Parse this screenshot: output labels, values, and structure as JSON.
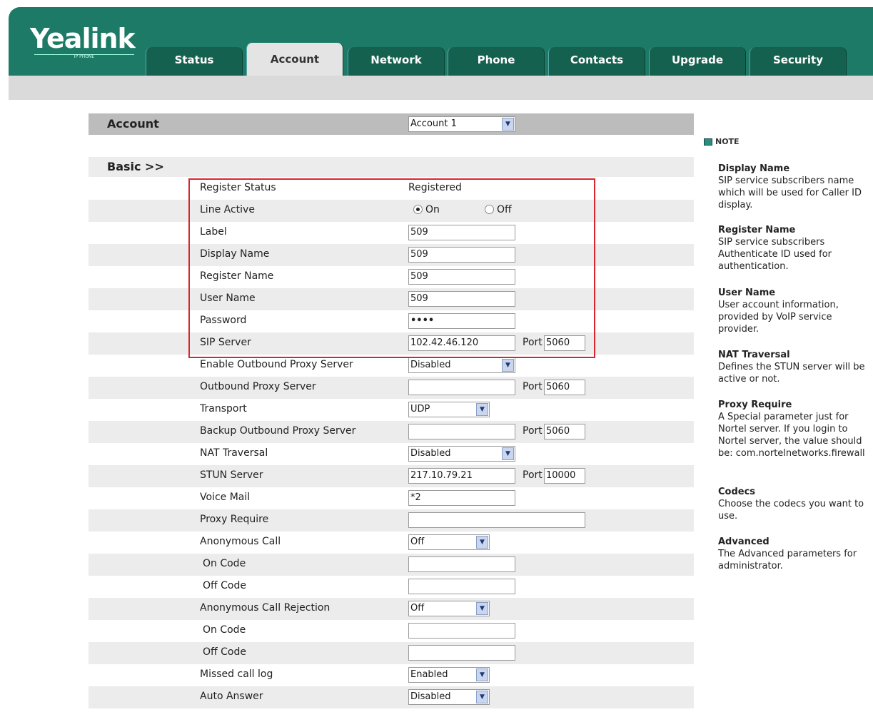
{
  "brand": {
    "logo": "Yealink",
    "tagline": "IP PHONE"
  },
  "tabs": [
    {
      "label": "Status",
      "active": false
    },
    {
      "label": "Account",
      "active": true
    },
    {
      "label": "Network",
      "active": false
    },
    {
      "label": "Phone",
      "active": false
    },
    {
      "label": "Contacts",
      "active": false
    },
    {
      "label": "Upgrade",
      "active": false
    },
    {
      "label": "Security",
      "active": false
    }
  ],
  "account": {
    "title": "Account",
    "selected": "Account 1"
  },
  "basic": {
    "title": "Basic >>"
  },
  "fields": {
    "register_status": {
      "label": "Register Status",
      "value": "Registered"
    },
    "line_active": {
      "label": "Line Active",
      "on": "On",
      "off": "Off",
      "selected": "On"
    },
    "label": {
      "label": "Label",
      "value": "509"
    },
    "display_name": {
      "label": "Display Name",
      "value": "509"
    },
    "register_name": {
      "label": "Register Name",
      "value": "509"
    },
    "user_name": {
      "label": "User Name",
      "value": "509"
    },
    "password": {
      "label": "Password",
      "value": "••••"
    },
    "sip_server": {
      "label": "SIP Server",
      "value": "102.42.46.120",
      "port_label": "Port",
      "port": "5060"
    },
    "enable_outbound": {
      "label": "Enable Outbound Proxy Server",
      "value": "Disabled"
    },
    "outbound_proxy": {
      "label": "Outbound Proxy Server",
      "value": "",
      "port_label": "Port",
      "port": "5060"
    },
    "transport": {
      "label": "Transport",
      "value": "UDP"
    },
    "backup_outbound": {
      "label": "Backup Outbound Proxy Server",
      "value": "",
      "port_label": "Port",
      "port": "5060"
    },
    "nat_traversal": {
      "label": "NAT Traversal",
      "value": "Disabled"
    },
    "stun_server": {
      "label": "STUN Server",
      "value": "217.10.79.21",
      "port_label": "Port",
      "port": "10000"
    },
    "voice_mail": {
      "label": "Voice Mail",
      "value": "*2"
    },
    "proxy_require": {
      "label": "Proxy Require",
      "value": ""
    },
    "anonymous_call": {
      "label": "Anonymous Call",
      "value": "Off"
    },
    "anon_on_code": {
      "label": "On Code",
      "value": ""
    },
    "anon_off_code": {
      "label": "Off Code",
      "value": ""
    },
    "anon_rejection": {
      "label": "Anonymous Call Rejection",
      "value": "Off"
    },
    "rej_on_code": {
      "label": "On Code",
      "value": ""
    },
    "rej_off_code": {
      "label": "Off Code",
      "value": ""
    },
    "missed_call_log": {
      "label": "Missed call log",
      "value": "Enabled"
    },
    "auto_answer": {
      "label": "Auto Answer",
      "value": "Disabled"
    }
  },
  "note": {
    "title": "NOTE",
    "items": [
      {
        "heading": "Display Name",
        "text": "SIP service subscribers name which will be used for Caller ID display."
      },
      {
        "heading": "Register Name",
        "text": "SIP service subscribers Authenticate ID used for authentication."
      },
      {
        "heading": "User Name",
        "text": "User account information, provided by VoIP service provider."
      },
      {
        "heading": "NAT Traversal",
        "text": "Defines the STUN server will be active or not."
      },
      {
        "heading": "Proxy Require",
        "text": "A Special parameter just for Nortel server. If you login to Nortel server, the value should be: com.nortelnetworks.firewall"
      },
      {
        "heading": "Codecs",
        "text": "Choose the codecs you want to use."
      },
      {
        "heading": "Advanced",
        "text": "The Advanced parameters for administrator."
      }
    ]
  },
  "colors": {
    "header": "#1d7a66",
    "highlight": "#d9262e"
  }
}
